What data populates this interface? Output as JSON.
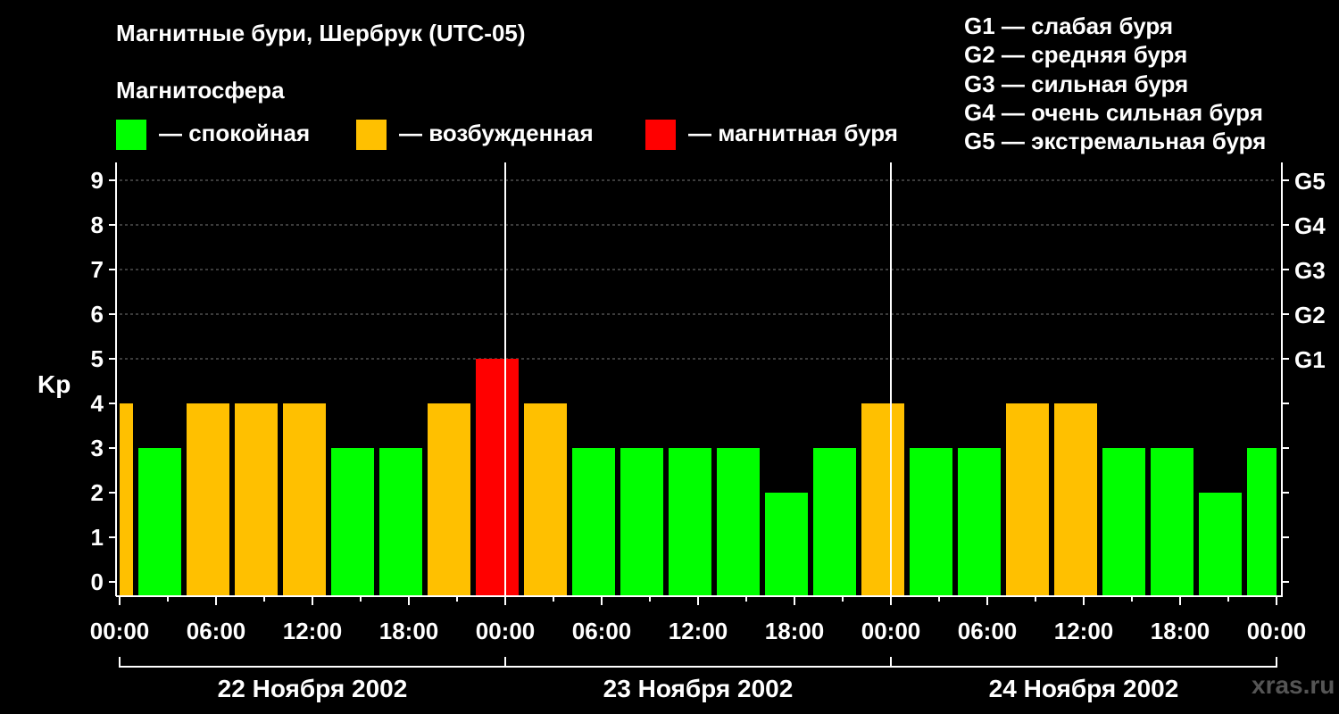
{
  "header": {
    "title": "Магнитные бури, Шербрук (UTC-05)",
    "magnetosphere_label": "Магнитосфера"
  },
  "legend": [
    {
      "label": "— спокойная",
      "color": "#00ff00"
    },
    {
      "label": "— возбужденная",
      "color": "#ffc000"
    },
    {
      "label": "— магнитная буря",
      "color": "#ff0000"
    }
  ],
  "g_scale": [
    "G1 — слабая буря",
    "G2 — средняя буря",
    "G3 — сильная буря",
    "G4 — очень сильная буря",
    "G5 — экстремальная буря"
  ],
  "watermark": "xras.ru",
  "chart_data": {
    "type": "bar",
    "ylabel": "Kp",
    "ylim": [
      0,
      9
    ],
    "y_ticks": [
      "0",
      "1",
      "2",
      "3",
      "4",
      "5",
      "6",
      "7",
      "8",
      "9"
    ],
    "right_axis_labels": [
      {
        "kp": 5,
        "label": "G1"
      },
      {
        "kp": 6,
        "label": "G2"
      },
      {
        "kp": 7,
        "label": "G3"
      },
      {
        "kp": 8,
        "label": "G4"
      },
      {
        "kp": 9,
        "label": "G5"
      }
    ],
    "x_range_hours": [
      0,
      72
    ],
    "x_tick_labels": [
      "00:00",
      "06:00",
      "12:00",
      "18:00",
      "00:00",
      "06:00",
      "12:00",
      "18:00",
      "00:00",
      "06:00",
      "12:00",
      "18:00",
      "00:00"
    ],
    "day_labels": [
      "22 Ноября 2002",
      "23 Ноября 2002",
      "24 Ноября 2002"
    ],
    "bars": [
      {
        "start": 0,
        "end": 1,
        "value": 4,
        "level": "возбужденная"
      },
      {
        "start": 1,
        "end": 4,
        "value": 3,
        "level": "спокойная"
      },
      {
        "start": 4,
        "end": 7,
        "value": 4,
        "level": "возбужденная"
      },
      {
        "start": 7,
        "end": 10,
        "value": 4,
        "level": "возбужденная"
      },
      {
        "start": 10,
        "end": 13,
        "value": 4,
        "level": "возбужденная"
      },
      {
        "start": 13,
        "end": 16,
        "value": 3,
        "level": "спокойная"
      },
      {
        "start": 16,
        "end": 19,
        "value": 3,
        "level": "спокойная"
      },
      {
        "start": 19,
        "end": 22,
        "value": 4,
        "level": "возбужденная"
      },
      {
        "start": 22,
        "end": 25,
        "value": 5,
        "level": "магнитная буря"
      },
      {
        "start": 25,
        "end": 28,
        "value": 4,
        "level": "возбужденная"
      },
      {
        "start": 28,
        "end": 31,
        "value": 3,
        "level": "спокойная"
      },
      {
        "start": 31,
        "end": 34,
        "value": 3,
        "level": "спокойная"
      },
      {
        "start": 34,
        "end": 37,
        "value": 3,
        "level": "спокойная"
      },
      {
        "start": 37,
        "end": 40,
        "value": 3,
        "level": "спокойная"
      },
      {
        "start": 40,
        "end": 43,
        "value": 2,
        "level": "спокойная"
      },
      {
        "start": 43,
        "end": 46,
        "value": 3,
        "level": "спокойная"
      },
      {
        "start": 46,
        "end": 49,
        "value": 4,
        "level": "возбужденная"
      },
      {
        "start": 49,
        "end": 52,
        "value": 3,
        "level": "спокойная"
      },
      {
        "start": 52,
        "end": 55,
        "value": 3,
        "level": "спокойная"
      },
      {
        "start": 55,
        "end": 58,
        "value": 4,
        "level": "возбужденная"
      },
      {
        "start": 58,
        "end": 61,
        "value": 4,
        "level": "возбужденная"
      },
      {
        "start": 61,
        "end": 64,
        "value": 3,
        "level": "спокойная"
      },
      {
        "start": 64,
        "end": 67,
        "value": 3,
        "level": "спокойная"
      },
      {
        "start": 67,
        "end": 70,
        "value": 2,
        "level": "спокойная"
      },
      {
        "start": 70,
        "end": 72,
        "value": 3,
        "level": "спокойная"
      }
    ],
    "level_colors": {
      "спокойная": "#00ff00",
      "возбужденная": "#ffc000",
      "магнитная буря": "#ff0000"
    },
    "grid": "dashed horizontal",
    "day_separators": true
  }
}
